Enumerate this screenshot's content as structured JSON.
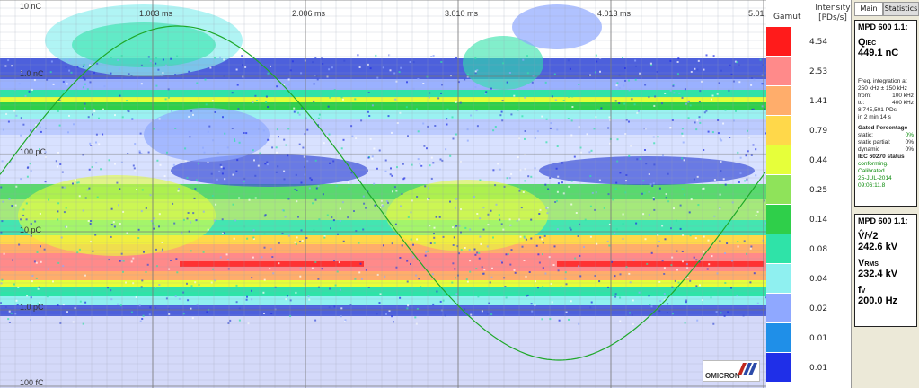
{
  "plot": {
    "y_labels": [
      "10 nC",
      "1.0 nC",
      "100 pC",
      "10 pC",
      "1.0 pC",
      "100 fC"
    ],
    "x_labels": [
      "1.003 ms",
      "2.006 ms",
      "3.010 ms",
      "4.013 ms",
      "5.01"
    ]
  },
  "legend": {
    "gamut_label": "Gamut",
    "intensity_label": "Intensity",
    "unit_label": "[PDs/s]",
    "levels": [
      {
        "value": "4.54",
        "color": "#ff1b1b"
      },
      {
        "value": "2.53",
        "color": "#ff8a8a"
      },
      {
        "value": "1.41",
        "color": "#ffad6b"
      },
      {
        "value": "0.79",
        "color": "#ffd84a"
      },
      {
        "value": "0.44",
        "color": "#e6ff3a"
      },
      {
        "value": "0.25",
        "color": "#8fe35a"
      },
      {
        "value": "0.14",
        "color": "#2fcf4a"
      },
      {
        "value": "0.08",
        "color": "#2fe3a8"
      },
      {
        "value": "0.04",
        "color": "#8ff0f0"
      },
      {
        "value": "0.02",
        "color": "#8fa8ff"
      },
      {
        "value": "0.01",
        "color": "#1f8fe8"
      },
      {
        "value": "0.01",
        "color": "#1f2fe8"
      }
    ]
  },
  "logo": {
    "text": "OMICRON"
  },
  "tabs": {
    "main": "Main",
    "statistics": "Statistics"
  },
  "panel1": {
    "title": "MPD 600 1.1:",
    "q_symbol": "Q",
    "q_sub": "IEC",
    "q_value": "449.1 nC",
    "freq_line1": "Freq. integration at",
    "freq_line2": "250 kHz ± 150 kHz",
    "from_label": "from:",
    "from_value": "100 kHz",
    "to_label": "to:",
    "to_value": "400 kHz",
    "pds": "8,745,501 PDs",
    "duration": "in  2 min 14 s",
    "gated_title": "Gated Percentage",
    "static_label": "static:",
    "static_value": "0%",
    "static_partial_label": "static partial:",
    "static_partial_value": "0%",
    "dynamic_label": "dynamic",
    "dynamic_value": "0%",
    "iec_title": "IEC 60270 status",
    "status": "conforming. Calibrated",
    "date": "25-JUL-2014",
    "time": "09:06:11.8"
  },
  "panel2": {
    "title": "MPD 600 1.1:",
    "v_symbol": "V̂/√2",
    "v_value": "242.6 kV",
    "vrms_symbol": "V",
    "vrms_sub": "RMS",
    "vrms_value": "232.4 kV",
    "f_symbol": "f",
    "f_sub": "V",
    "f_value": "200.0 Hz"
  },
  "colors": {
    "sine": "#1fa82a",
    "panel_border": "#222222"
  }
}
